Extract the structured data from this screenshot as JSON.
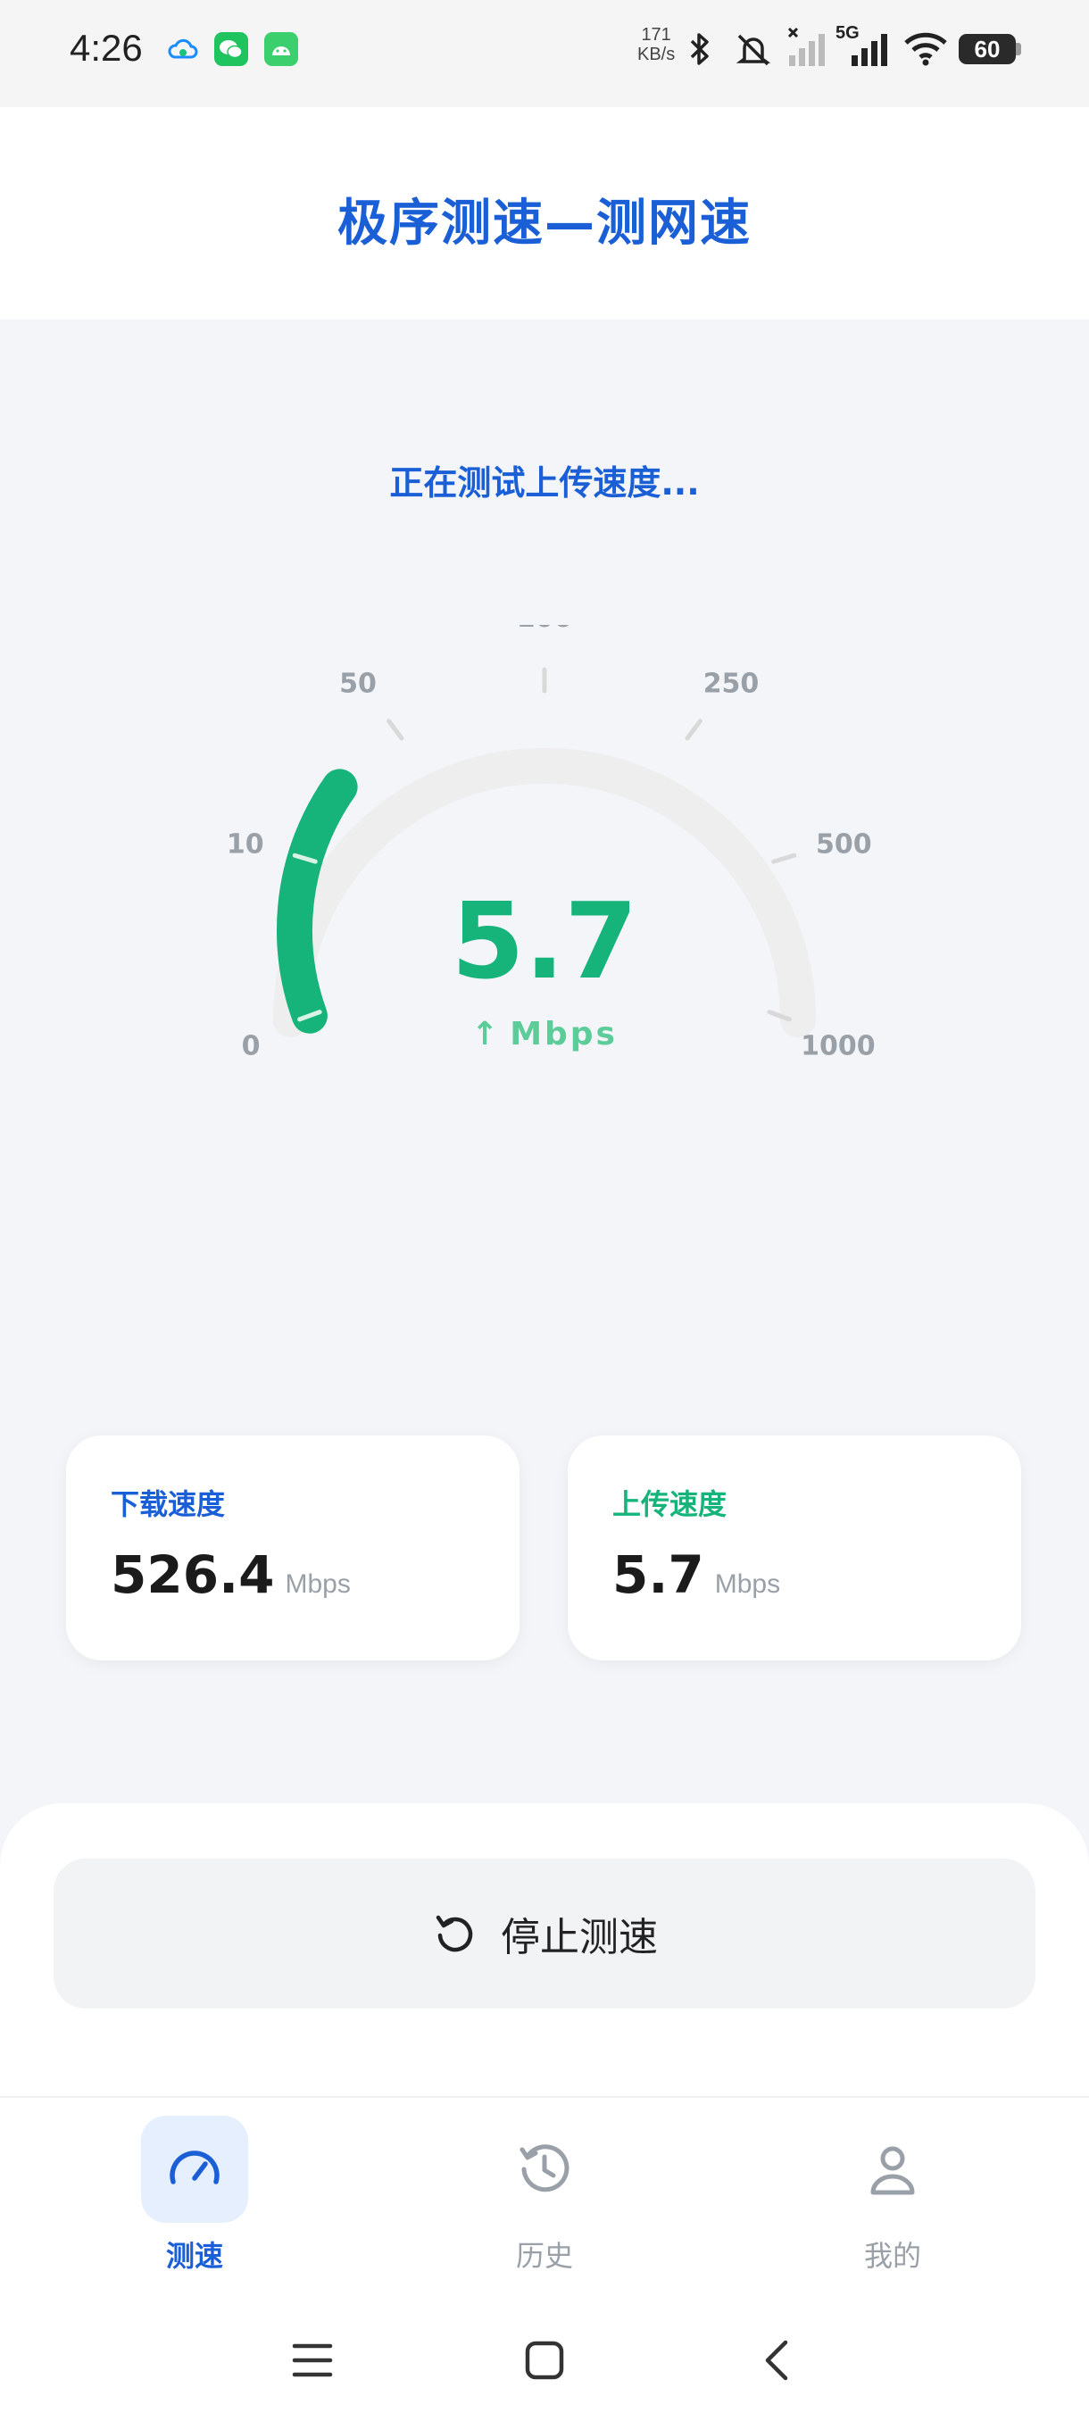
{
  "status_bar": {
    "time": "4:26",
    "net_speed_value": "171",
    "net_speed_unit": "KB/s",
    "network_type": "5G",
    "battery": "60",
    "icons": [
      "cloud-icon",
      "wechat-icon",
      "android-icon",
      "bluetooth-icon",
      "mute-icon",
      "signal-off-icon",
      "signal-5g-icon",
      "wifi-icon",
      "battery-icon"
    ]
  },
  "header": {
    "title": "极序测速—测网速"
  },
  "test": {
    "status": "正在测试上传速度...",
    "current_value": "5.7",
    "unit": "Mbps",
    "direction_icon": "up-arrow-icon",
    "gauge_scale": [
      "0",
      "10",
      "50",
      "100",
      "250",
      "500",
      "1000"
    ],
    "gauge_fill_fraction": 0.25,
    "accent_color": "#16b47a",
    "track_color": "#eeeeee"
  },
  "results": {
    "download": {
      "label": "下载速度",
      "value": "526.4",
      "unit": "Mbps"
    },
    "upload": {
      "label": "上传速度",
      "value": "5.7",
      "unit": "Mbps"
    }
  },
  "action": {
    "stop_label": "停止测速",
    "icon": "restart-icon"
  },
  "nav": [
    {
      "label": "测速",
      "icon": "speedometer-icon",
      "active": true
    },
    {
      "label": "历史",
      "icon": "history-icon",
      "active": false
    },
    {
      "label": "我的",
      "icon": "profile-icon",
      "active": false
    }
  ],
  "colors": {
    "primary": "#1a5fd6",
    "success": "#16b47a",
    "background": "#f3f5f9"
  }
}
